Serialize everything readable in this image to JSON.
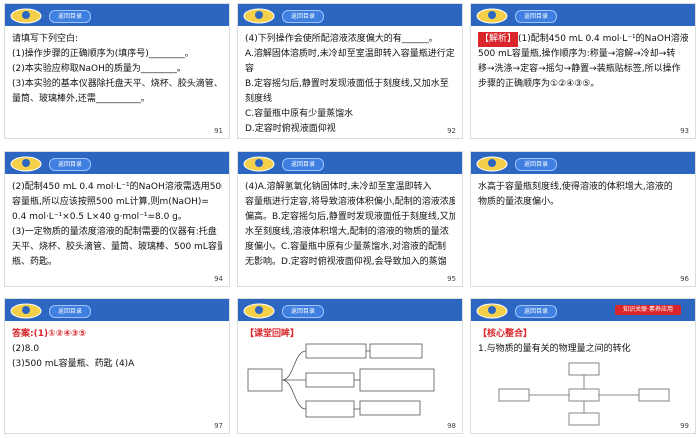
{
  "colors": {
    "header_blue": "#2c66c0",
    "accent_red": "#d8262b"
  },
  "header_pill_label": "返回目录",
  "slides": [
    {
      "page": "91",
      "lines": [
        "请填写下列空白:",
        "(1)操作步骤的正确顺序为(填序号)________。",
        "(2)本实验应称取NaOH的质量为________。",
        "(3)本实验的基本仪器除托盘天平、烧杯、胶头滴管、",
        "量筒、玻璃棒外,还需__________。"
      ]
    },
    {
      "page": "92",
      "lines": [
        "(4)下列操作会使所配溶液浓度偏大的有______。",
        "A.溶解固体溶质时,未冷却至室温即转入容量瓶进行定",
        "容",
        "B.定容摇匀后,静置时发现液面低于刻度线,又加水至",
        "刻度线",
        "C.容量瓶中原有少量蒸馏水",
        "D.定容时俯视液面仰视"
      ]
    },
    {
      "page": "93",
      "label": "【解析】",
      "lines": [
        "(1)配制450 mL 0.4 mol·L⁻¹的NaOH溶液需选用",
        "500 mL容量瓶,操作顺序为:称量→溶解→冷却→转",
        "移→洗涤→定容→摇匀→静置→装瓶贴标签,所以操作",
        "步骤的正确顺序为①②④③⑤。"
      ]
    },
    {
      "page": "94",
      "lines": [
        "(2)配制450 mL 0.4 mol·L⁻¹的NaOH溶液需选用500 mL",
        "容量瓶,所以应该按照500 mL计算,则m(NaOH)=",
        "0.4 mol·L⁻¹×0.5 L×40 g·mol⁻¹=8.0 g。",
        "(3)一定物质的量浓度溶液的配制需要的仪器有:托盘",
        "天平、烧杯、胶头滴管、量筒、玻璃棒、500 mL容量",
        "瓶、药匙。"
      ]
    },
    {
      "page": "95",
      "lines": [
        "(4)A.溶解氢氧化钠固体时,未冷却至室温即转入",
        "容量瓶进行定容,将导致溶液体积偏小,配制的溶液浓度",
        "偏高。B.定容摇匀后,静置时发现液面低于刻度线,又加",
        "水至刻度线,溶液体积增大,配制的溶液的物质的量浓",
        "度偏小。C.容量瓶中原有少量蒸馏水,对溶液的配制",
        "无影响。D.定容时俯视液面仰视,会导致加入的蒸馏"
      ]
    },
    {
      "page": "96",
      "lines": [
        "水高于容量瓶刻度线,使得溶液的体积增大,溶液的",
        "物质的量浓度偏小。"
      ]
    },
    {
      "page": "97",
      "label": "答案:",
      "lines": [
        "(1)①②④③⑤",
        "(2)8.0",
        "(3)500 mL容量瓶、药匙  (4)A"
      ]
    },
    {
      "page": "98",
      "label": "【课堂回眸】"
    },
    {
      "page": "99",
      "tag": "知识关联·素养应用",
      "label": "【核心整合】",
      "lines": [
        "1.与物质的量有关的物理量之间的转化"
      ]
    }
  ]
}
